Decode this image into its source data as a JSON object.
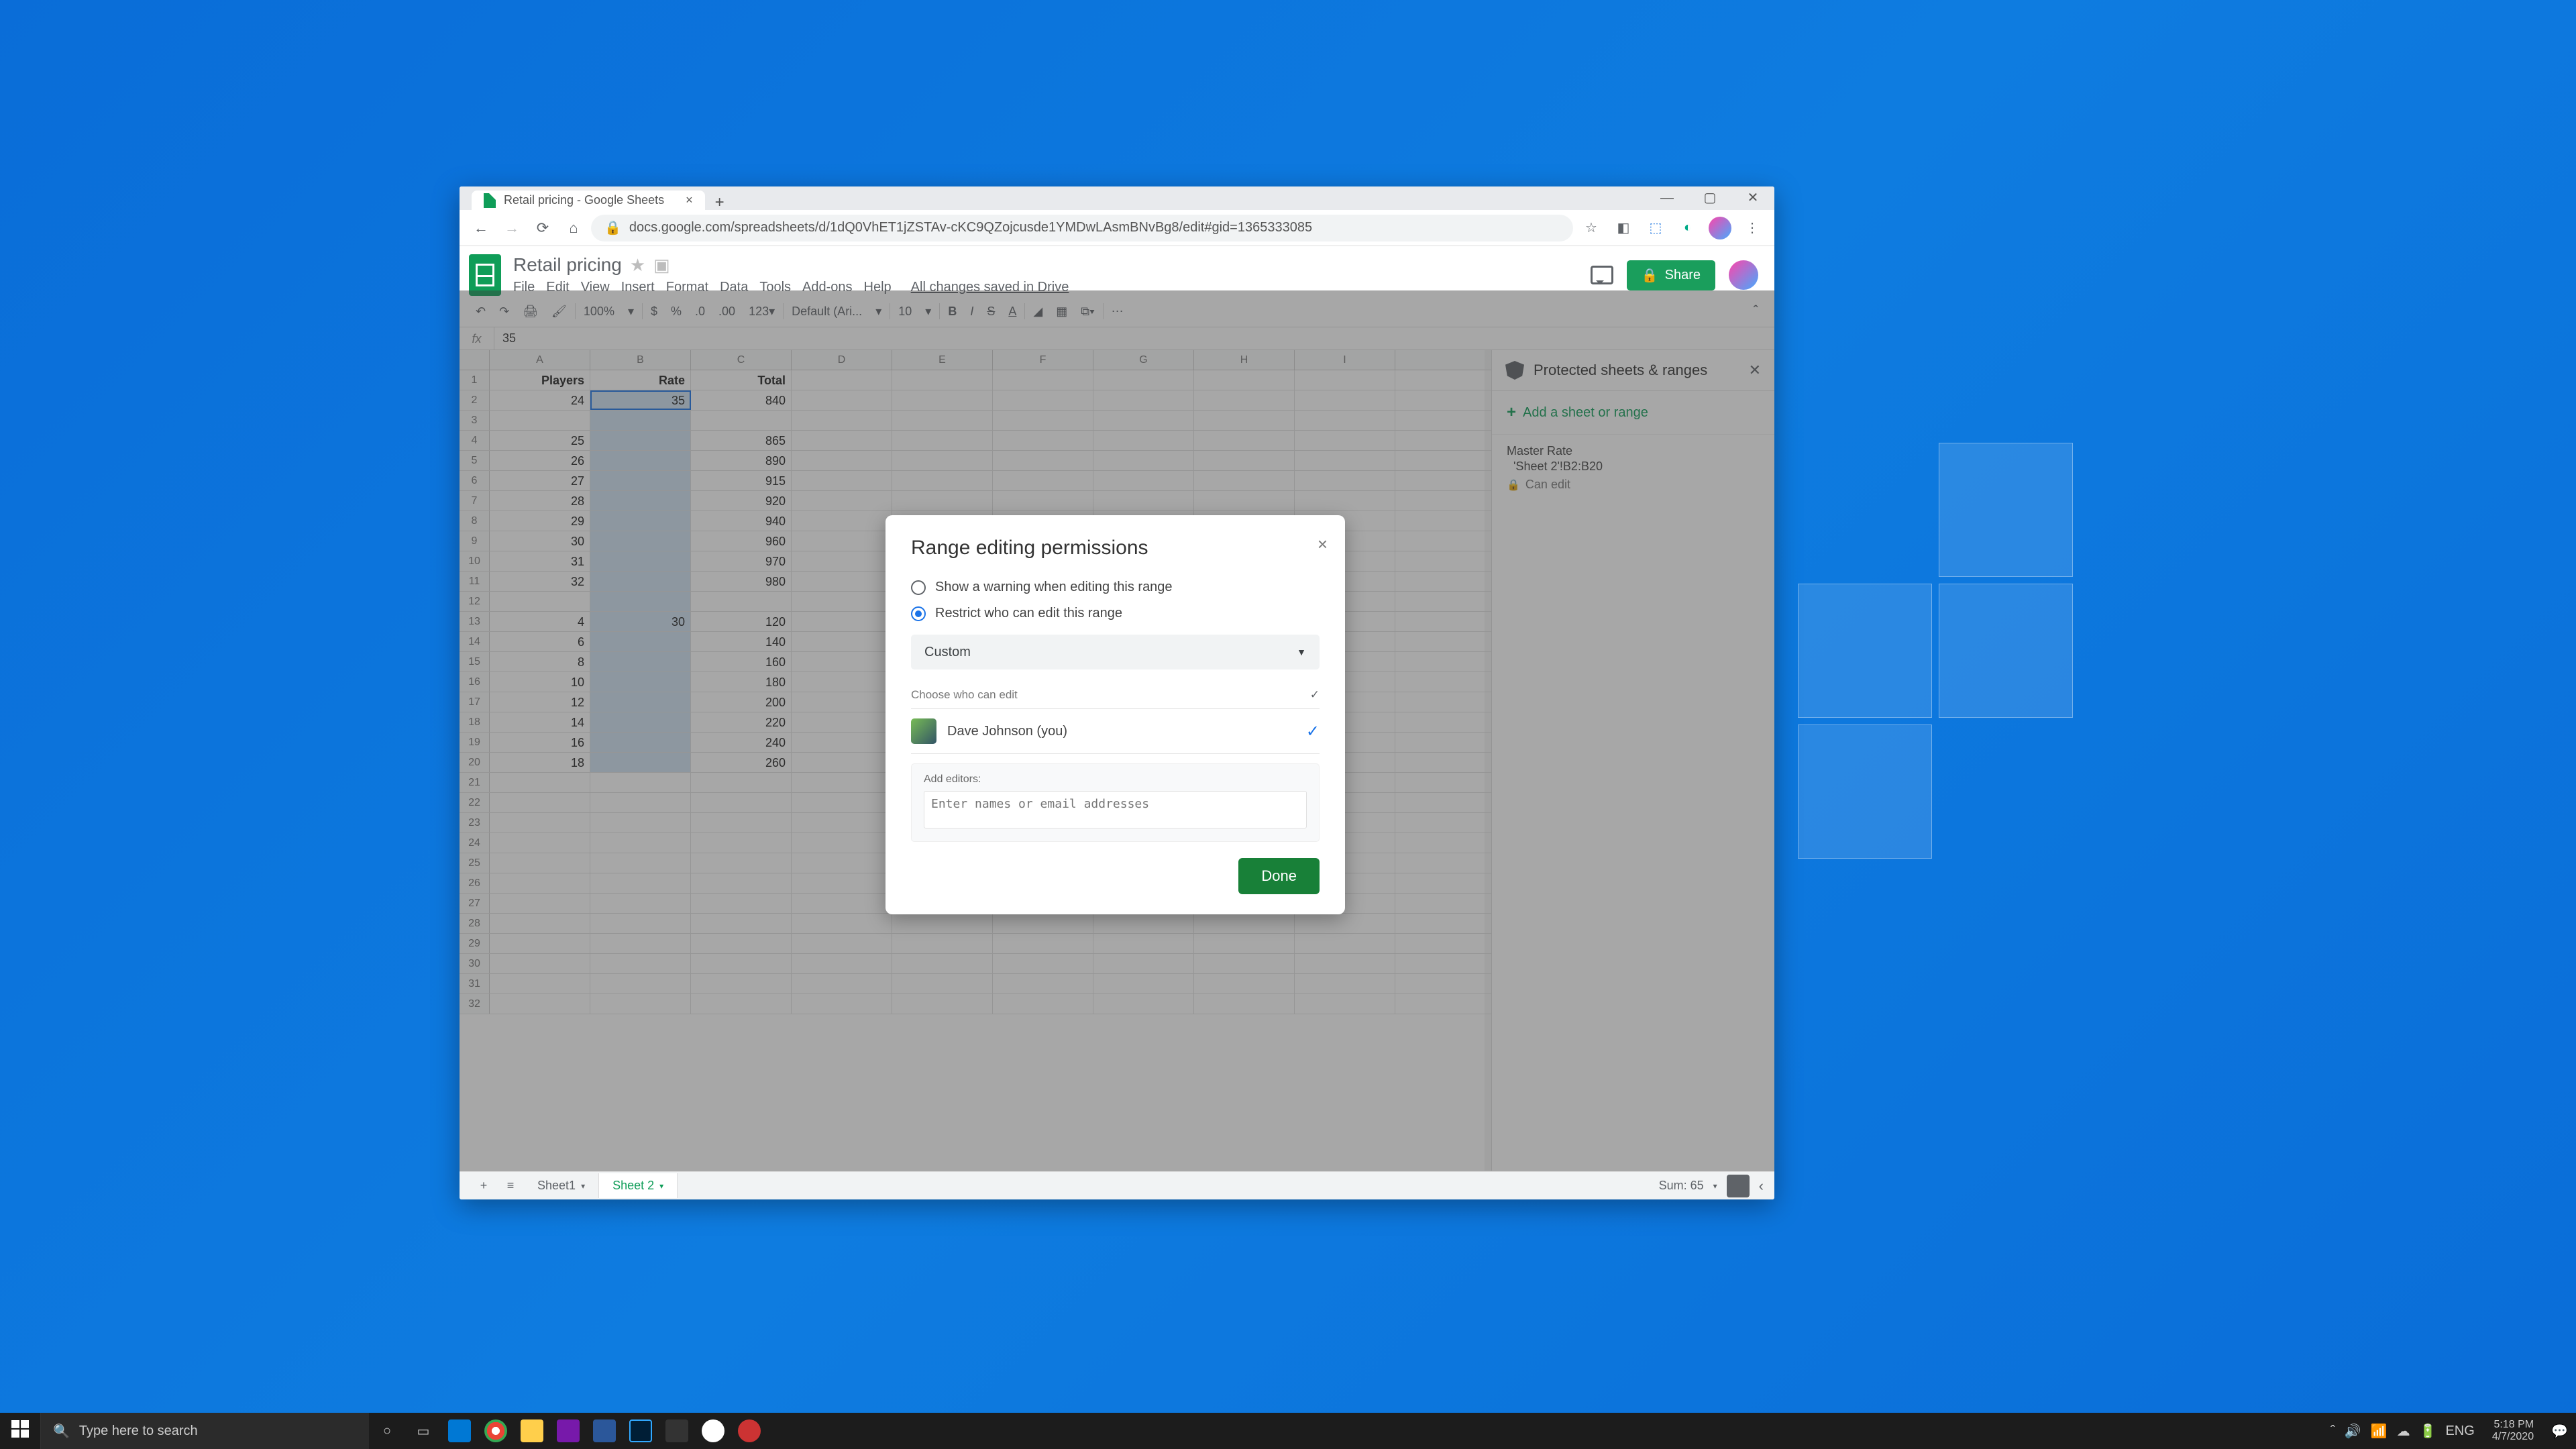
{
  "browser": {
    "tab_title": "Retail pricing - Google Sheets",
    "url": "docs.google.com/spreadsheets/d/1dQ0VhET1jZSTAv-cKC9QZojcusde1YMDwLAsmBNvBg8/edit#gid=1365333085"
  },
  "sheets": {
    "title": "Retail pricing",
    "menus": [
      "File",
      "Edit",
      "View",
      "Insert",
      "Format",
      "Data",
      "Tools",
      "Add-ons",
      "Help"
    ],
    "drive_status": "All changes saved in Drive",
    "share_label": "Share",
    "zoom": "100%",
    "font": "Default (Ari...",
    "font_size": "10",
    "formula_value": "35",
    "columns": [
      "A",
      "B",
      "C",
      "D",
      "E",
      "F",
      "G",
      "H",
      "I"
    ],
    "headers": {
      "A": "Players",
      "B": "Rate",
      "C": "Total"
    },
    "active_cell_value": "35",
    "rows": [
      {
        "n": 2,
        "A": "24",
        "B": "35",
        "C": "840"
      },
      {
        "n": 3,
        "A": "",
        "B": "",
        "C": ""
      },
      {
        "n": 4,
        "A": "25",
        "B": "",
        "C": "865"
      },
      {
        "n": 5,
        "A": "26",
        "B": "",
        "C": "890"
      },
      {
        "n": 6,
        "A": "27",
        "B": "",
        "C": "915"
      },
      {
        "n": 7,
        "A": "28",
        "B": "",
        "C": "920"
      },
      {
        "n": 8,
        "A": "29",
        "B": "",
        "C": "940"
      },
      {
        "n": 9,
        "A": "30",
        "B": "",
        "C": "960"
      },
      {
        "n": 10,
        "A": "31",
        "B": "",
        "C": "970"
      },
      {
        "n": 11,
        "A": "32",
        "B": "",
        "C": "980"
      },
      {
        "n": 12,
        "A": "",
        "B": "",
        "C": ""
      },
      {
        "n": 13,
        "A": "4",
        "B": "30",
        "C": "120"
      },
      {
        "n": 14,
        "A": "6",
        "B": "",
        "C": "140"
      },
      {
        "n": 15,
        "A": "8",
        "B": "",
        "C": "160"
      },
      {
        "n": 16,
        "A": "10",
        "B": "",
        "C": "180"
      },
      {
        "n": 17,
        "A": "12",
        "B": "",
        "C": "200"
      },
      {
        "n": 18,
        "A": "14",
        "B": "",
        "C": "220"
      },
      {
        "n": 19,
        "A": "16",
        "B": "",
        "C": "240"
      },
      {
        "n": 20,
        "A": "18",
        "B": "",
        "C": "260"
      }
    ],
    "empty_rows": [
      21,
      22,
      23,
      24,
      25,
      26,
      27,
      28,
      29,
      30,
      31,
      32
    ],
    "sheet_tabs": {
      "sheet1": "Sheet1",
      "sheet2": "Sheet 2"
    },
    "sum_label": "Sum: 65"
  },
  "sidepanel": {
    "title": "Protected sheets & ranges",
    "add_label": "Add a sheet or range",
    "entry": {
      "name": "Master Rate",
      "range": "'Sheet 2'!B2:B20",
      "perm": "Can edit"
    }
  },
  "dialog": {
    "title": "Range editing permissions",
    "opt_warn": "Show a warning when editing this range",
    "opt_restrict": "Restrict who can edit this range",
    "dropdown": "Custom",
    "choose_label": "Choose who can edit",
    "person": "Dave Johnson (you)",
    "add_label": "Add editors:",
    "add_placeholder": "Enter names or email addresses",
    "done": "Done"
  },
  "taskbar": {
    "search_placeholder": "Type here to search",
    "time": "5:18 PM",
    "date": "4/7/2020"
  }
}
